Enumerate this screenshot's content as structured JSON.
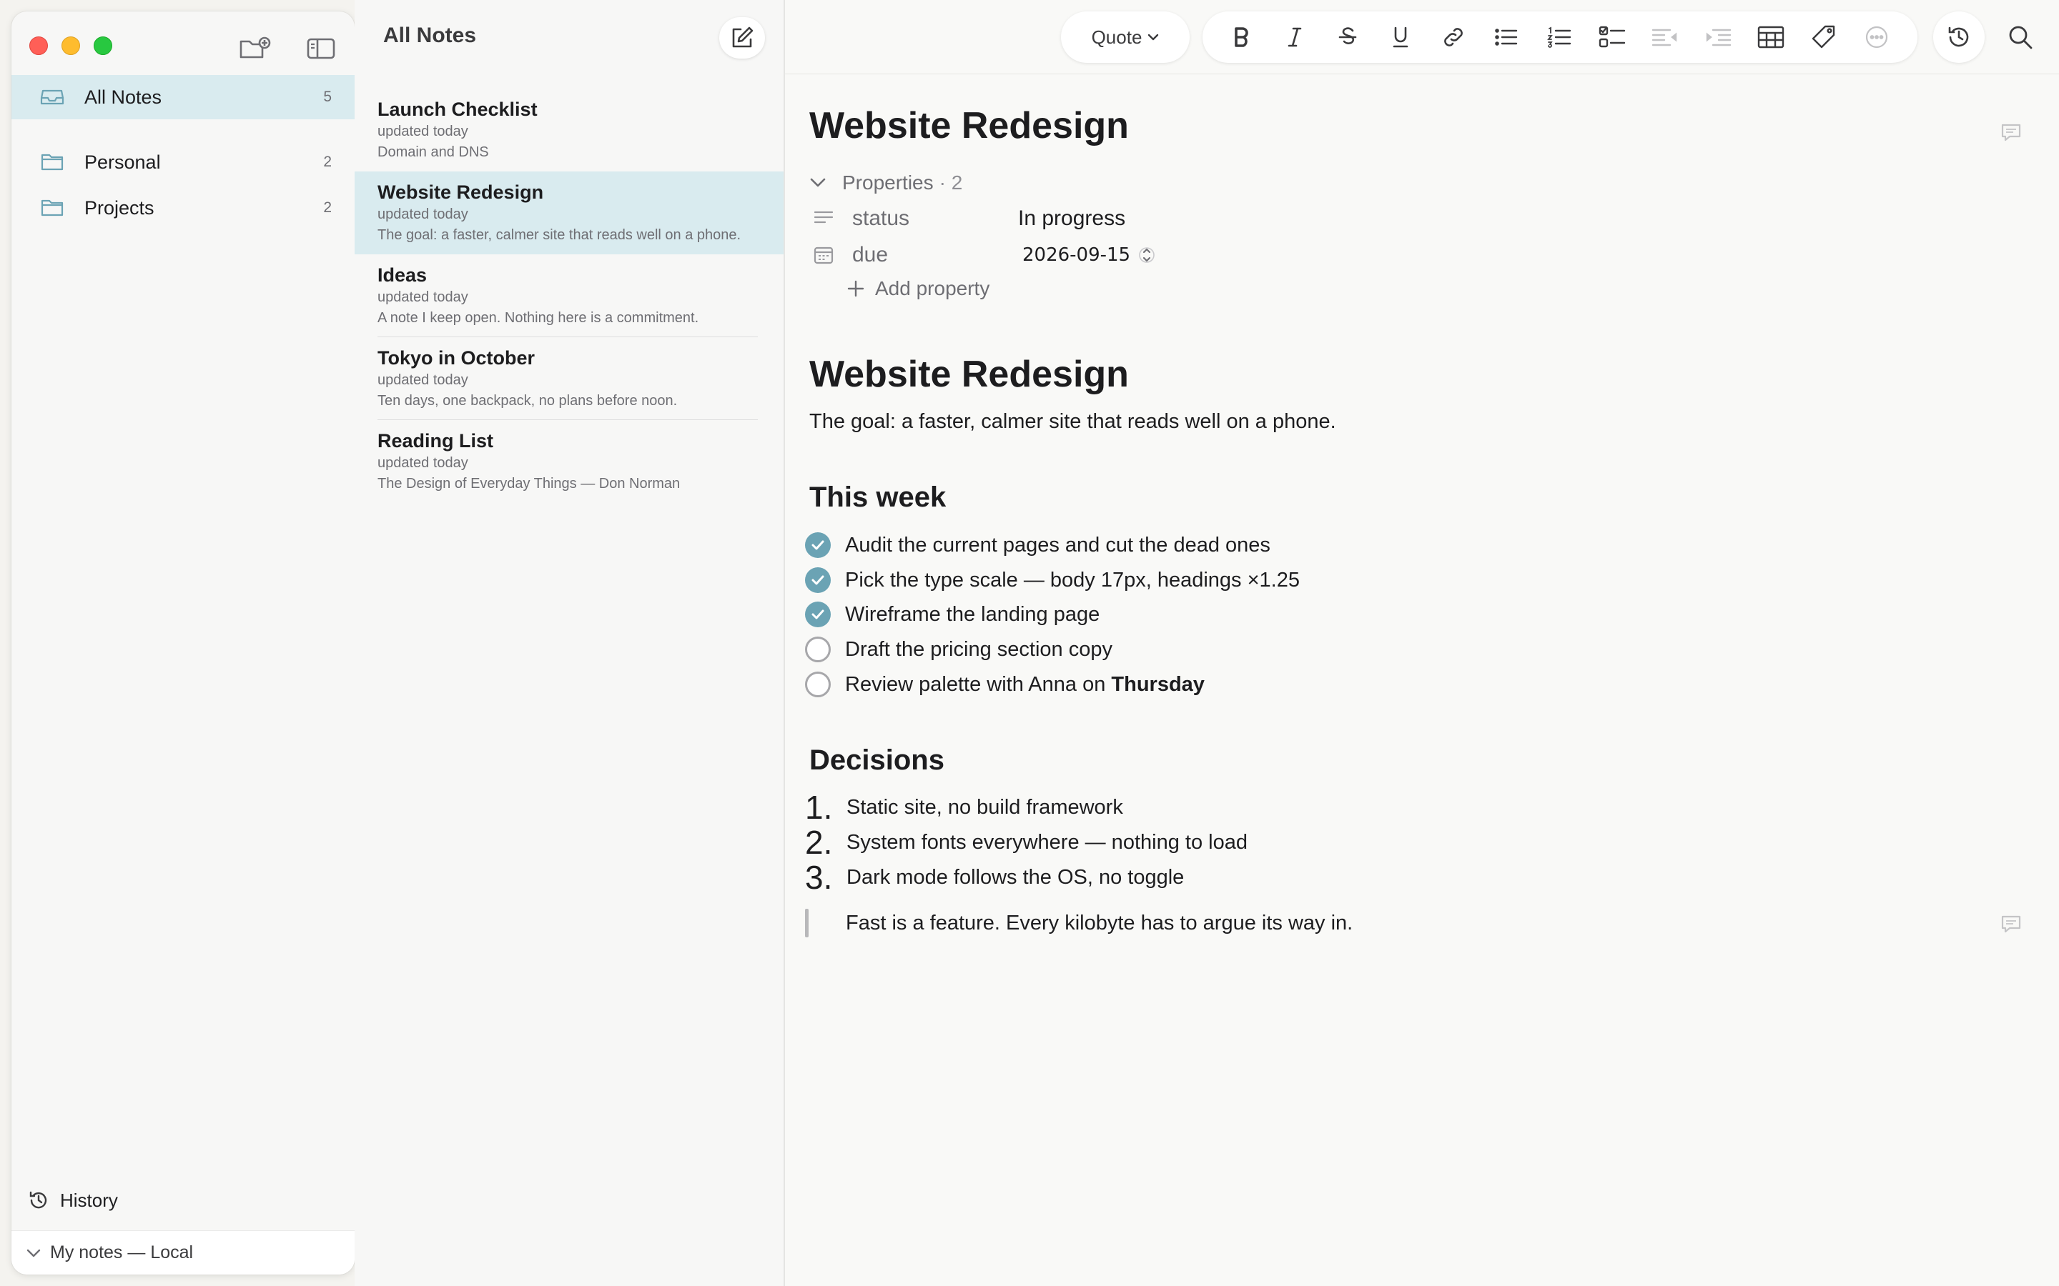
{
  "sidebar": {
    "items": [
      {
        "label": "All Notes",
        "count": "5"
      },
      {
        "label": "Personal",
        "count": "2"
      },
      {
        "label": "Projects",
        "count": "2"
      }
    ],
    "history_label": "History",
    "account_label": "My notes — Local"
  },
  "notelist": {
    "title": "All Notes",
    "notes": [
      {
        "title": "Launch Checklist",
        "date": "updated today",
        "preview": "Domain and DNS"
      },
      {
        "title": "Website Redesign",
        "date": "updated today",
        "preview": "The goal: a faster, calmer site that reads well on a phone."
      },
      {
        "title": "Ideas",
        "date": "updated today",
        "preview": "A note I keep open. Nothing here is a commitment."
      },
      {
        "title": "Tokyo in October",
        "date": "updated today",
        "preview": "Ten days, one backpack, no plans before noon."
      },
      {
        "title": "Reading List",
        "date": "updated today",
        "preview": "The Design of Everyday Things — Don Norman"
      }
    ]
  },
  "toolbar": {
    "block_style": "Quote"
  },
  "editor": {
    "title": "Website Redesign",
    "properties": {
      "label": "Properties",
      "count": "· 2",
      "rows": [
        {
          "name": "status",
          "value": "In progress"
        },
        {
          "name": "due",
          "value": "2026-09-15"
        }
      ],
      "add_label": "Add property"
    },
    "heading": "Website Redesign",
    "intro": "The goal: a faster, calmer site that reads well on a phone.",
    "section_week": "This week",
    "tasks": [
      {
        "text": "Audit the current pages and cut the dead ones",
        "done": true
      },
      {
        "text": "Pick the type scale — body 17px, headings ×1.25",
        "done": true
      },
      {
        "text": "Wireframe the landing page",
        "done": true
      },
      {
        "text": "Draft the pricing section copy",
        "done": false
      },
      {
        "text": "Review palette with Anna on ",
        "bold": "Thursday",
        "done": false
      }
    ],
    "section_decisions": "Decisions",
    "decisions": [
      {
        "num": "1.",
        "text": "Static site, no build framework"
      },
      {
        "num": "2.",
        "text": "System fonts everywhere — nothing to load"
      },
      {
        "num": "3.",
        "text": "Dark mode follows the OS, no toggle"
      }
    ],
    "quote": "Fast is a feature. Every kilobyte has to argue its way in."
  },
  "colors": {
    "accent": "#6ba3b4",
    "selection": "#d9ebef",
    "close": "#ff5f57",
    "minimize": "#febc2e",
    "zoom": "#28c840"
  }
}
